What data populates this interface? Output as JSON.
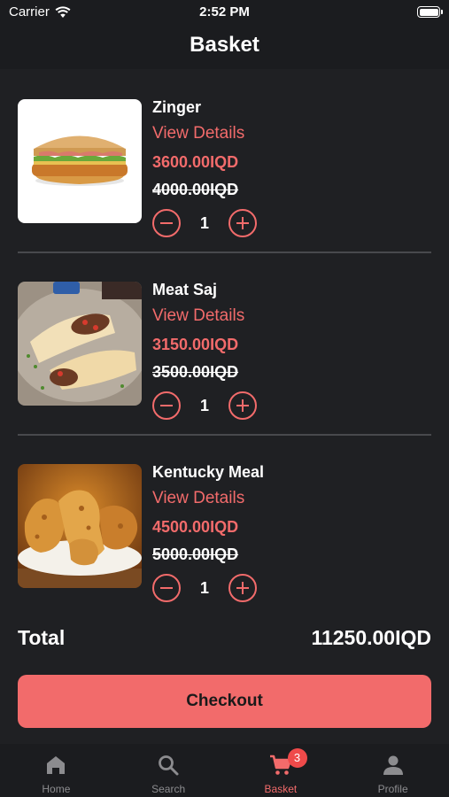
{
  "status_bar": {
    "carrier": "Carrier",
    "time": "2:52 PM"
  },
  "header": {
    "title": "Basket"
  },
  "items": [
    {
      "name": "Zinger",
      "details_label": "View Details",
      "price": "3600.00IQD",
      "old_price": "4000.00IQD",
      "quantity": "1",
      "image": "chicken-sandwich"
    },
    {
      "name": "Meat Saj",
      "details_label": "View Details",
      "price": "3150.00IQD",
      "old_price": "3500.00IQD",
      "quantity": "1",
      "image": "meat-wrap"
    },
    {
      "name": "Kentucky Meal",
      "details_label": "View Details",
      "price": "4500.00IQD",
      "old_price": "5000.00IQD",
      "quantity": "1",
      "image": "fried-chicken"
    }
  ],
  "summary": {
    "total_label": "Total",
    "total_value": "11250.00IQD"
  },
  "checkout": {
    "label": "Checkout"
  },
  "tabbar": {
    "tabs": [
      {
        "label": "Home",
        "icon": "home-icon",
        "active": false
      },
      {
        "label": "Search",
        "icon": "search-icon",
        "active": false
      },
      {
        "label": "Basket",
        "icon": "cart-icon",
        "active": true,
        "badge": "3"
      },
      {
        "label": "Profile",
        "icon": "person-icon",
        "active": false
      }
    ]
  },
  "colors": {
    "accent": "#f26b6b",
    "background": "#1f2023",
    "bar": "#1b1c1f",
    "badge": "#ef4a4a"
  }
}
